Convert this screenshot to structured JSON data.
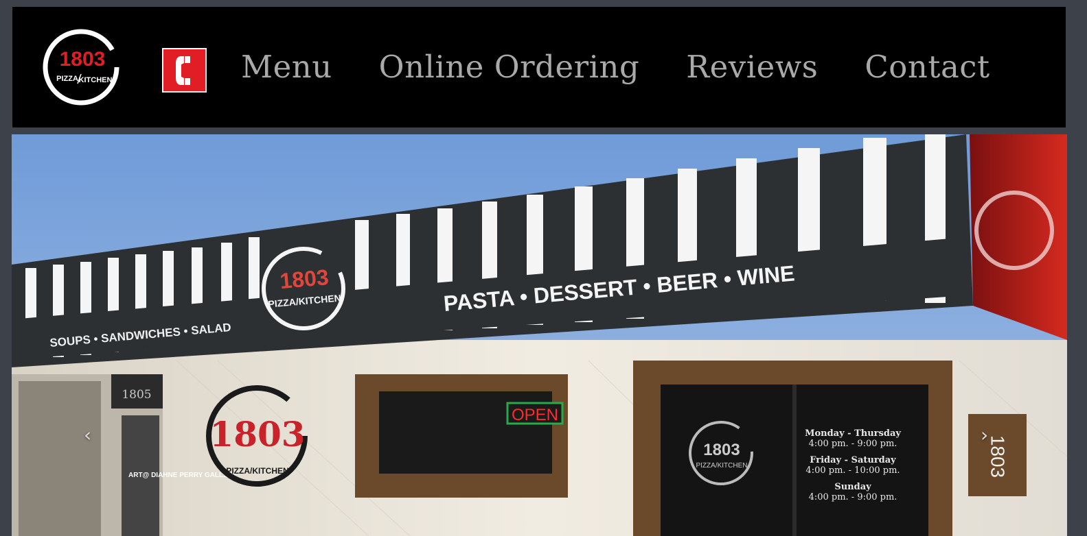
{
  "brand": {
    "logo_number": "1803",
    "logo_sub_left": "PIZZA",
    "logo_sub_right": "KITCHEN",
    "accent_color": "#e11e25"
  },
  "header": {
    "phone_icon": "phone-icon",
    "nav": [
      {
        "label": "Menu"
      },
      {
        "label": "Online Ordering"
      },
      {
        "label": "Reviews"
      },
      {
        "label": "Contact"
      }
    ]
  },
  "hero": {
    "awning_left_text": "SOUPS • SANDWICHES • SALAD",
    "awning_right_text": "PASTA • DESSERT • BEER • WINE",
    "awning_logo_number": "1803",
    "awning_logo_sub": "PIZZA/KITCHEN",
    "wall_logo_number": "1803",
    "wall_logo_sub": "PIZZA/KITCHEN",
    "door_logo_number": "1803",
    "door_logo_sub": "PIZZA/KITCHEN",
    "neighbor_number": "1805",
    "open_sign": "OPEN",
    "hours": [
      {
        "days": "Monday - Thursday",
        "time": "4:00 pm. - 9:00 pm."
      },
      {
        "days": "Friday - Saturday",
        "time": "4:00 pm. - 10:00 pm."
      },
      {
        "days": "Sunday",
        "time": "4:00 pm. - 9:00 pm."
      }
    ],
    "address_sign": "1803",
    "gallery_sign": "ART@ DIAHNE PERRY GALLERY",
    "prev_arrow": "‹",
    "next_arrow": "›"
  }
}
